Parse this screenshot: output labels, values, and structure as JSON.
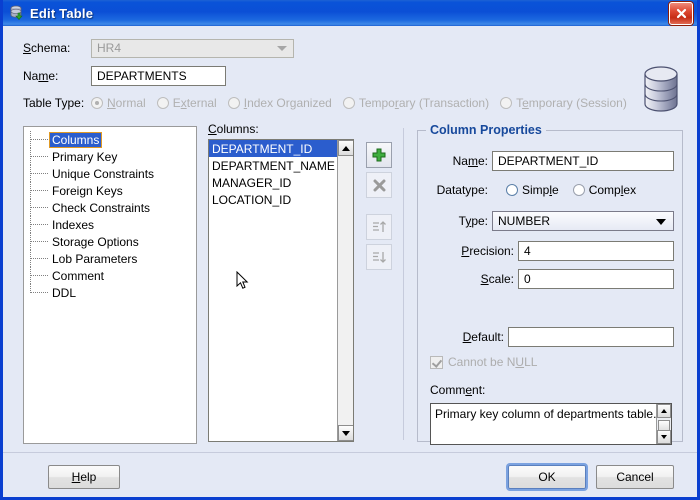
{
  "window": {
    "title": "Edit Table",
    "title_icon": "database-table-icon",
    "close_icon": "close-icon",
    "accent_color": "#0a53d8",
    "background_color": "#e4e9f5"
  },
  "header": {
    "schema_label": "Schema:",
    "schema_value": "HR4",
    "schema_disabled": true,
    "name_label": "Name:",
    "name_value": "DEPARTMENTS",
    "table_type_label": "Table Type:",
    "table_type_options": [
      {
        "label": "Normal",
        "selected": true
      },
      {
        "label": "External",
        "selected": false
      },
      {
        "label": "Index Organized",
        "selected": false
      },
      {
        "label": "Temporary (Transaction)",
        "selected": false
      },
      {
        "label": "Temporary (Session)",
        "selected": false
      }
    ],
    "side_icon": "database-cylinder-icon"
  },
  "tree": {
    "items": [
      {
        "label": "Columns",
        "selected": true
      },
      {
        "label": "Primary Key",
        "selected": false
      },
      {
        "label": "Unique Constraints",
        "selected": false
      },
      {
        "label": "Foreign Keys",
        "selected": false
      },
      {
        "label": "Check Constraints",
        "selected": false
      },
      {
        "label": "Indexes",
        "selected": false
      },
      {
        "label": "Storage Options",
        "selected": false
      },
      {
        "label": "Lob Parameters",
        "selected": false
      },
      {
        "label": "Comment",
        "selected": false
      },
      {
        "label": "DDL",
        "selected": false
      }
    ]
  },
  "columns_panel": {
    "label": "Columns:",
    "items": [
      {
        "name": "DEPARTMENT_ID",
        "selected": true
      },
      {
        "name": "DEPARTMENT_NAME",
        "selected": false
      },
      {
        "name": "MANAGER_ID",
        "selected": false
      },
      {
        "name": "LOCATION_ID",
        "selected": false
      }
    ],
    "scroll_up_icon": "scroll-up-arrow-icon",
    "scroll_down_icon": "scroll-down-arrow-icon"
  },
  "toolbar": {
    "add_icon": "plus-icon",
    "remove_icon": "x-icon",
    "move_up_icon": "move-up-icon",
    "move_down_icon": "move-down-icon"
  },
  "properties": {
    "legend": "Column Properties",
    "name_label": "Name:",
    "name_value": "DEPARTMENT_ID",
    "datatype_label": "Datatype:",
    "datatype_options": [
      {
        "label": "Simple",
        "selected": true
      },
      {
        "label": "Complex",
        "selected": false
      }
    ],
    "type_label": "Type:",
    "type_value": "NUMBER",
    "precision_label": "Precision:",
    "precision_value": "4",
    "scale_label": "Scale:",
    "scale_value": "0",
    "default_label": "Default:",
    "default_value": "",
    "cannot_be_null_label": "Cannot be NULL",
    "cannot_be_null_checked": true,
    "cannot_be_null_disabled": true,
    "comment_label": "Comment:",
    "comment_value": "Primary key column of departments table."
  },
  "footer": {
    "help_label": "Help",
    "ok_label": "OK",
    "cancel_label": "Cancel"
  }
}
